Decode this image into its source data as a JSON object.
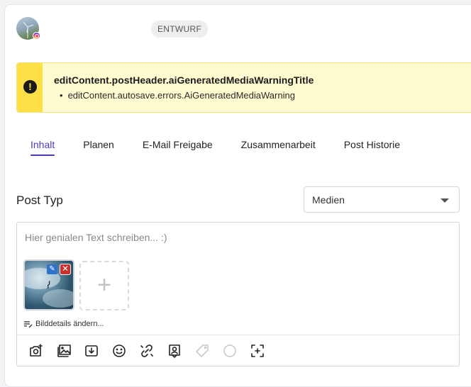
{
  "header": {
    "status_badge": "ENTWURF",
    "account_network": "instagram"
  },
  "warning": {
    "title": "editContent.postHeader.aiGeneratedMediaWarningTitle",
    "items": [
      "editContent.autosave.errors.AiGeneratedMediaWarning"
    ],
    "accent_color": "#fde047"
  },
  "tabs": [
    {
      "label": "Inhalt",
      "active": true
    },
    {
      "label": "Planen",
      "active": false
    },
    {
      "label": "E-Mail Freigabe",
      "active": false
    },
    {
      "label": "Zusammenarbeit",
      "active": false
    },
    {
      "label": "Post Historie",
      "active": false
    }
  ],
  "post_type": {
    "label": "Post Typ",
    "selected": "Medien"
  },
  "editor": {
    "placeholder": "Hier genialen Text schreiben... :)",
    "media_details_link": "Bilddetails ändern..."
  },
  "toolbar": {
    "icons": [
      "camera-add-icon",
      "gallery-icon",
      "download-icon",
      "emoji-icon",
      "link-icon",
      "profile-tag-icon",
      "tag-icon",
      "circle-icon",
      "crop-icon"
    ]
  },
  "colors": {
    "accent": "#4b3bb8",
    "delete": "#d22d2d",
    "edit": "#2f74c9"
  }
}
